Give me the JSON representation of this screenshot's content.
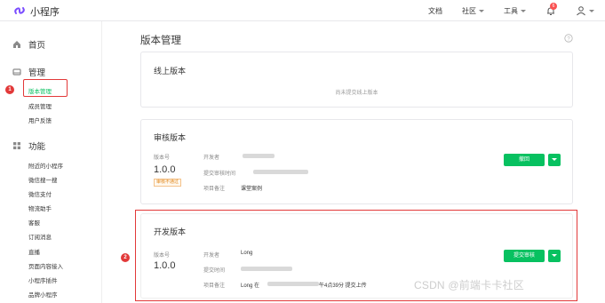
{
  "app": {
    "title": "小程序"
  },
  "topnav": {
    "docs": "文档",
    "community": "社区",
    "tools": "工具",
    "notification_count": "6"
  },
  "sidebar": {
    "home": "首页",
    "manage": {
      "label": "管理",
      "items": [
        "版本管理",
        "成员管理",
        "用户反馈"
      ]
    },
    "features": {
      "label": "功能",
      "items": [
        "附近的小程序",
        "微信搜一搜",
        "微信支付",
        "物流助手",
        "客服",
        "订阅消息",
        "直播",
        "页面内容接入",
        "小程序插件",
        "品牌小程序"
      ]
    },
    "active_item": "版本管理"
  },
  "main": {
    "page_title": "版本管理",
    "online": {
      "title": "线上版本",
      "empty_text": "尚未提交线上版本"
    },
    "review": {
      "title": "审核版本",
      "version_label": "版本号",
      "version": "1.0.0",
      "status_tag": "审核不通过",
      "fields": {
        "developer": "开发者",
        "submit_time": "提交审核时间",
        "note": "项目备注"
      },
      "note_value": "课堂案例",
      "action_button": "撤回"
    },
    "dev": {
      "title": "开发版本",
      "version_label": "版本号",
      "version": "1.0.0",
      "fields": {
        "developer": "开发者",
        "submit_time": "提交时间",
        "note": "项目备注"
      },
      "developer_value": "Long",
      "note_prefix": "Long 在",
      "note_suffix": "午4点39分 提交上传",
      "action_button": "提交审核"
    }
  },
  "annotations": {
    "marker_1": "1",
    "marker_2": "2"
  },
  "watermark": "CSDN @前端卡卡社区",
  "colors": {
    "accent": "#07c160",
    "annotation": "#e23939"
  }
}
